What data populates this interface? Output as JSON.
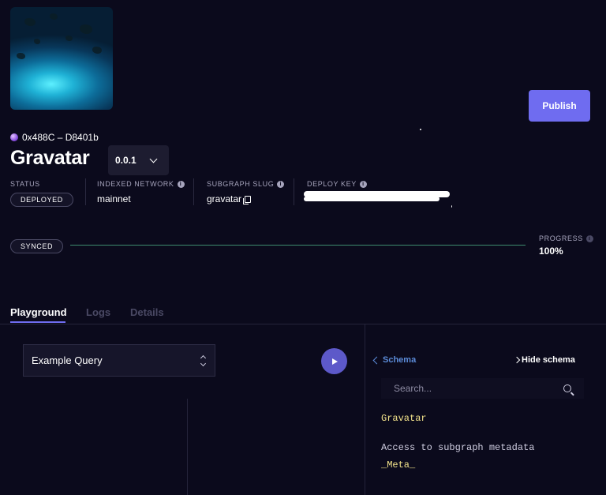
{
  "header": {
    "address": "0x488C – D8401b",
    "title": "Gravatar",
    "version": "0.0.1",
    "publish_label": "Publish"
  },
  "meta": {
    "status_label": "STATUS",
    "status_value": "DEPLOYED",
    "network_label": "INDEXED NETWORK",
    "network_value": "mainnet",
    "slug_label": "SUBGRAPH SLUG",
    "slug_value": "gravatar",
    "deploy_key_label": "DEPLOY KEY"
  },
  "sync": {
    "status": "SYNCED",
    "progress_label": "PROGRESS",
    "progress_value": "100%",
    "progress_fraction": 1.0
  },
  "tabs": [
    {
      "label": "Playground",
      "active": true
    },
    {
      "label": "Logs",
      "active": false
    },
    {
      "label": "Details",
      "active": false
    }
  ],
  "playground": {
    "query_select": "Example Query"
  },
  "schema": {
    "back_label": "Schema",
    "hide_label": "Hide schema",
    "search_placeholder": "Search...",
    "type_name": "Gravatar",
    "meta_description": "Access to subgraph metadata",
    "meta_field": "_Meta_"
  },
  "colors": {
    "background": "#0b0a1c",
    "accent": "#6f6cf0",
    "link": "#5b8bd8",
    "sync_line": "#3e8c6e",
    "type_yellow": "#f3e38b"
  }
}
